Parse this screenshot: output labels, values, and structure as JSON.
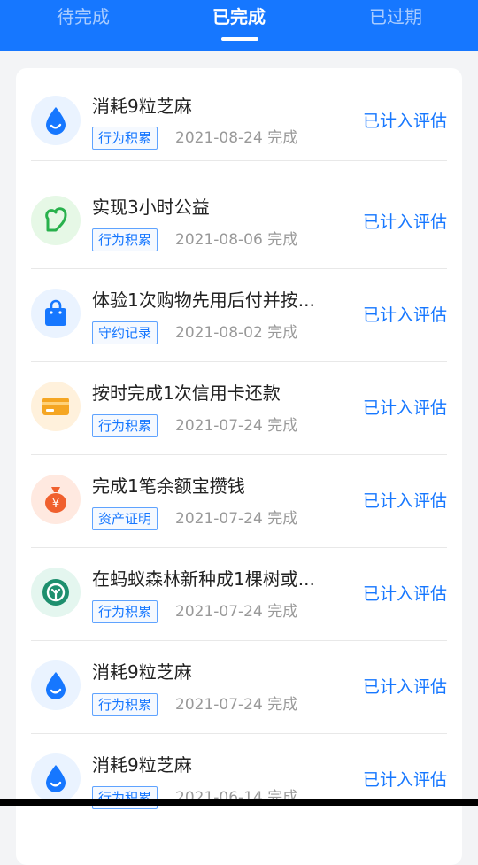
{
  "tabs": [
    {
      "label": "待完成",
      "active": false
    },
    {
      "label": "已完成",
      "active": true
    },
    {
      "label": "已过期",
      "active": false
    }
  ],
  "colors": {
    "primary": "#1677ff",
    "tag_border": "#5fa3ff",
    "muted_text": "#999999"
  },
  "items": [
    {
      "title": "消耗9粒芝麻",
      "tag": "行为积累",
      "date": "2021-08-24 完成",
      "status": "已计入评估",
      "icon": "sesame-drop-icon",
      "icon_color": "#1677ff",
      "icon_bg": "#eaf3ff"
    },
    {
      "title": "实现3小时公益",
      "tag": "行为积累",
      "date": "2021-08-06 完成",
      "status": "已计入评估",
      "icon": "charity-heart-icon",
      "icon_color": "#28b14c",
      "icon_bg": "#e6f8e6"
    },
    {
      "title": "体验1次购物先用后付并按...",
      "tag": "守约记录",
      "date": "2021-08-02 完成",
      "status": "已计入评估",
      "icon": "shopping-bag-icon",
      "icon_color": "#1677ff",
      "icon_bg": "#eaf3ff"
    },
    {
      "title": "按时完成1次信用卡还款",
      "tag": "行为积累",
      "date": "2021-07-24 完成",
      "status": "已计入评估",
      "icon": "credit-card-icon",
      "icon_color": "#f5a623",
      "icon_bg": "#fff1dc"
    },
    {
      "title": "完成1笔余额宝攒钱",
      "tag": "资产证明",
      "date": "2021-07-24 完成",
      "status": "已计入评估",
      "icon": "money-bag-icon",
      "icon_color": "#f0602e",
      "icon_bg": "#ffe9e0"
    },
    {
      "title": "在蚂蚁森林新种成1棵树或...",
      "tag": "行为积累",
      "date": "2021-07-24 完成",
      "status": "已计入评估",
      "icon": "forest-tree-icon",
      "icon_color": "#1e8f6e",
      "icon_bg": "#e4f6ef"
    },
    {
      "title": "消耗9粒芝麻",
      "tag": "行为积累",
      "date": "2021-07-24 完成",
      "status": "已计入评估",
      "icon": "sesame-drop-icon",
      "icon_color": "#1677ff",
      "icon_bg": "#eaf3ff"
    },
    {
      "title": "消耗9粒芝麻",
      "tag": "行为积累",
      "date": "2021-06-14 完成",
      "status": "已计入评估",
      "icon": "sesame-drop-icon",
      "icon_color": "#1677ff",
      "icon_bg": "#eaf3ff"
    }
  ]
}
